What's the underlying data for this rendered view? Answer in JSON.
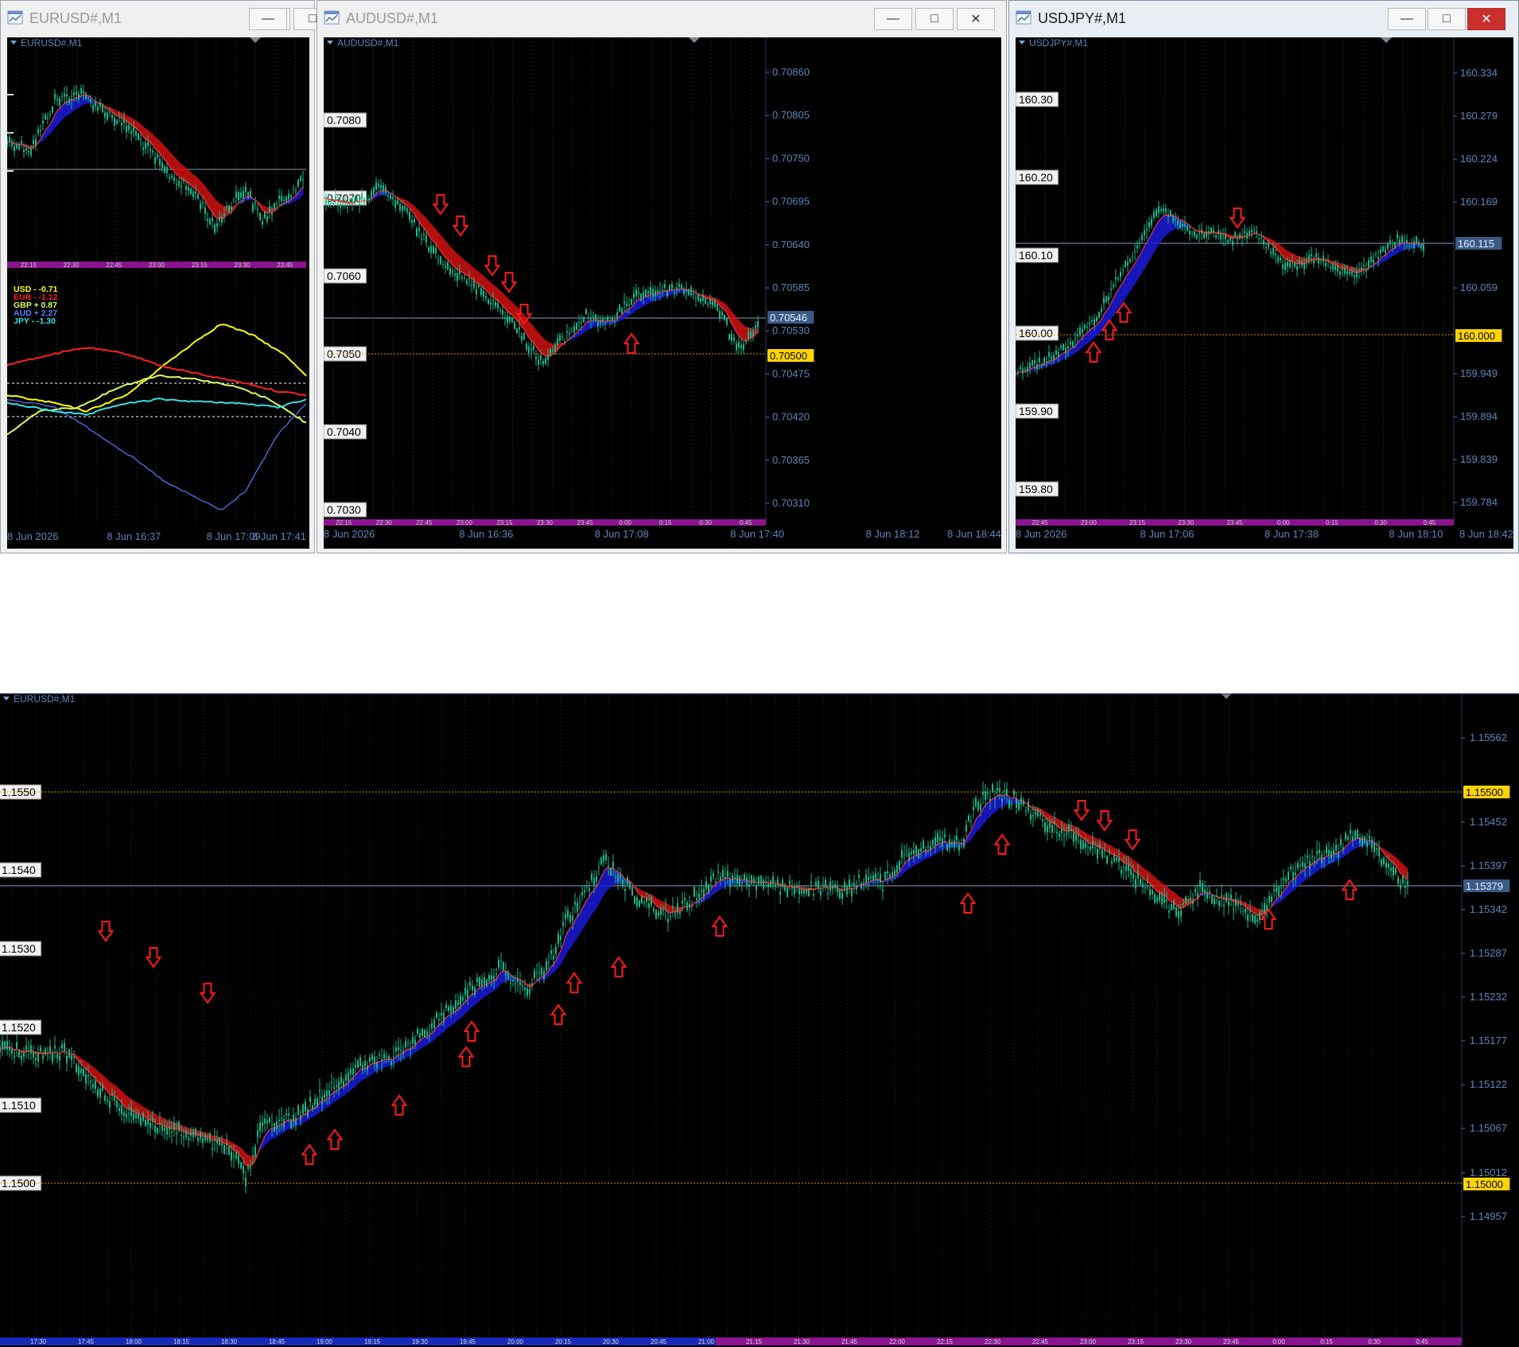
{
  "windows": {
    "eurusd_small": {
      "title": "EURUSD#,M1",
      "chart_label": "EURUSD#,M1",
      "time_strip": [
        "22:15",
        "22:30",
        "22:45",
        "23:00",
        "23:15",
        "23:30",
        "23:45"
      ],
      "date_labels": [
        "8 Jun 2026",
        "8 Jun 16:37",
        "8 Jun 17:09",
        "8 Jun 17:41"
      ],
      "currency_strength": [
        {
          "label": "USD -  -0.71",
          "color": "#ffff00"
        },
        {
          "label": "EUR -  -1.12",
          "color": "#ff2020"
        },
        {
          "label": "GBP +  0.87",
          "color": "#d8ff60"
        },
        {
          "label": "AUD +  2.27",
          "color": "#5a7cff"
        },
        {
          "label": "JPY -  -1.30",
          "color": "#38e0e0"
        }
      ]
    },
    "audusd": {
      "title": "AUDUSD#,M1",
      "chart_label": "AUDUSD#,M1",
      "left_levels": [
        "0.7080",
        "0.7070",
        "0.7060",
        "0.7050",
        "0.7040",
        "0.7030"
      ],
      "right_axis": [
        "0.70860",
        "0.70805",
        "0.70750",
        "0.70695",
        "0.70640",
        "0.70585",
        "0.70530",
        "0.70475",
        "0.70420",
        "0.70365",
        "0.70310"
      ],
      "current_price": "0.70546",
      "level_price": "0.70500",
      "time_strip": [
        "22:15",
        "22:30",
        "22:45",
        "23:00",
        "23:15",
        "23:30",
        "23:45",
        "0:00",
        "0:15",
        "0:30",
        "0:45"
      ],
      "date_labels": [
        "8 Jun 2026",
        "8 Jun 16:36",
        "8 Jun 17:08",
        "8 Jun 17:40",
        "8 Jun 18:12",
        "8 Jun 18:44"
      ]
    },
    "usdjpy": {
      "title": "USDJPY#,M1",
      "chart_label": "USDJPY#,M1",
      "left_levels": [
        "160.30",
        "160.20",
        "160.10",
        "160.00",
        "159.90",
        "159.80"
      ],
      "right_axis": [
        "160.334",
        "160.279",
        "160.224",
        "160.169",
        "160.059",
        "159.949",
        "159.894",
        "159.839",
        "159.784"
      ],
      "current_price": "160.115",
      "level_price": "160.000",
      "time_strip": [
        "22:45",
        "23:00",
        "23:15",
        "23:30",
        "23:45",
        "0:00",
        "0:15",
        "0:30",
        "0:45"
      ],
      "date_labels": [
        "8 Jun 2026",
        "8 Jun 17:06",
        "8 Jun 17:38",
        "8 Jun 18:10",
        "8 Jun 18:42"
      ]
    },
    "eurusd_large": {
      "chart_label": "EURUSD#,M1",
      "left_levels": [
        "1.1550",
        "1.1540",
        "1.1530",
        "1.1520",
        "1.1510",
        "1.1500"
      ],
      "right_axis": [
        "1.15562",
        "1.15452",
        "1.15397",
        "1.15342",
        "1.15287",
        "1.15232",
        "1.15177",
        "1.15122",
        "1.15067",
        "1.15012",
        "1.14957"
      ],
      "current_price": "1.15379",
      "level_high": "1.15500",
      "level_low": "1.15000",
      "time_strip": [
        "17:30",
        "17:45",
        "18:00",
        "18:15",
        "18:30",
        "18:45",
        "19:00",
        "19:15",
        "19:30",
        "19:45",
        "20:00",
        "20:15",
        "20:30",
        "20:45",
        "21:00",
        "21:15",
        "21:30",
        "21:45",
        "22:00",
        "22:15",
        "22:30",
        "22:45",
        "23:00",
        "23:15",
        "23:30",
        "23:45",
        "0:00",
        "0:15",
        "0:30",
        "0:45"
      ]
    }
  },
  "colors": {
    "background": "#000000",
    "candle": "#16b88a",
    "ma_red": "#d01010",
    "ma_blue": "#1a1ad8",
    "signal_arrow": "#ff1a1a",
    "level_line": "#d4a000",
    "price_line": "#8c9db8",
    "time_strip": "#8a1490",
    "axis_text": "#5f86b8"
  }
}
